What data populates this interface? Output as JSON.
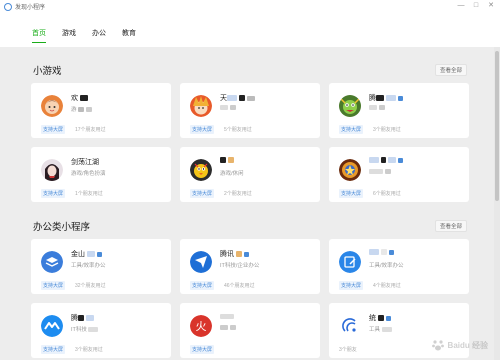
{
  "window": {
    "title": "发现小程序",
    "buttons": [
      "—",
      "□",
      "✕"
    ]
  },
  "nav": {
    "tabs": [
      {
        "label": "首页",
        "active": true
      },
      {
        "label": "游戏",
        "active": false
      },
      {
        "label": "办公",
        "active": false
      },
      {
        "label": "教育",
        "active": false
      }
    ],
    "active_color": "#1aad19"
  },
  "sections": [
    {
      "title": "小游戏",
      "view_all": "查看全部",
      "cards": [
        {
          "name": "欢",
          "desc": "游",
          "badge": "支持大屏",
          "friends": "17个朋友用过",
          "icon": "cartoon-girl-icon"
        },
        {
          "name": "天",
          "desc": "",
          "badge": "支持大屏",
          "friends": "5个朋友用过",
          "icon": "anime-character-icon"
        },
        {
          "name": "腾",
          "desc": "",
          "badge": "支持大屏",
          "friends": "3个朋友用过",
          "icon": "game-monster-icon"
        },
        {
          "name": "剑荡江湖",
          "desc": "游戏/角色扮演",
          "badge": "支持大屏",
          "friends": "1个朋友用过",
          "icon": "swordsman-portrait-icon"
        },
        {
          "name": "",
          "desc": "游戏/休闲",
          "badge": "支持大屏",
          "friends": "2个朋友用过",
          "icon": "bird-character-icon"
        },
        {
          "name": "",
          "desc": "",
          "badge": "支持大屏",
          "friends": "6个朋友用过",
          "icon": "fantasy-badge-icon"
        }
      ]
    },
    {
      "title": "办公类小程序",
      "view_all": "查看全部",
      "cards": [
        {
          "name": "金山",
          "desc": "工具/效率办公",
          "badge": "支持大屏",
          "friends": "32个朋友用过",
          "icon": "blue-layers-icon"
        },
        {
          "name": "腾讯",
          "desc": "IT科技/企业办公",
          "badge": "支持大屏",
          "friends": "46个朋友用过",
          "icon": "blue-send-icon"
        },
        {
          "name": "",
          "desc": "工具/效率办公",
          "badge": "支持大屏",
          "friends": "4个朋友用过",
          "icon": "edit-doc-icon"
        },
        {
          "name": "腾",
          "desc": "IT科技",
          "badge": "支持大屏",
          "friends": "3个朋友用过",
          "icon": "meeting-icon"
        },
        {
          "name": "",
          "desc": "",
          "badge": "支持大屏",
          "friends": "",
          "icon": "red-seal-icon"
        },
        {
          "name": "统",
          "desc": "工具",
          "badge": "",
          "friends": "3个朋友",
          "icon": "signal-arc-icon"
        }
      ]
    }
  ],
  "watermark": "Baidu 经验"
}
